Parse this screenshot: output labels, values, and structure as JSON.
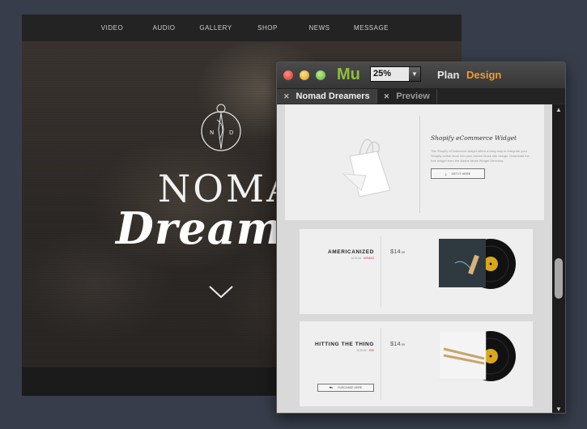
{
  "site": {
    "nav": [
      "VIDEO",
      "AUDIO",
      "GALLERY",
      "SHOP",
      "NEWS",
      "MESSAGE"
    ],
    "logo_letters": [
      "N",
      "D"
    ],
    "brand_top": "NOMAD",
    "brand_bottom": "Dreamers"
  },
  "window": {
    "app_logo": "Mu",
    "zoom_value": "25%",
    "mode_plan": "Plan",
    "mode_design": "Design",
    "tabs": [
      {
        "label": "Nomad Dreamers",
        "active": true
      },
      {
        "label": "Preview",
        "active": false
      }
    ]
  },
  "widget": {
    "title": "Shopify eCommerce Widget",
    "description": "The Shopify eCommerce widget offers a easy way to integrate your Shopify online store into your Adobe Muse site design. Download the free widget from the Adobe Muse Widget Directory.",
    "button": "GET IT HERE"
  },
  "products": [
    {
      "name": "AMERICANIZED",
      "sub_prefix": "ALBUM · ",
      "sub_highlight": "NOMAD",
      "price": "$14",
      "cents": ".99",
      "button": ""
    },
    {
      "name": "HITTING THE THING",
      "sub_prefix": "ALBUM · ",
      "sub_highlight": "EMI",
      "price": "$14",
      "cents": ".99",
      "button": "PURCHASE HERE"
    }
  ],
  "colors": {
    "accent_design": "#f09a2d",
    "muse_green": "#8fbf3c",
    "desktop": "#373d4a"
  }
}
